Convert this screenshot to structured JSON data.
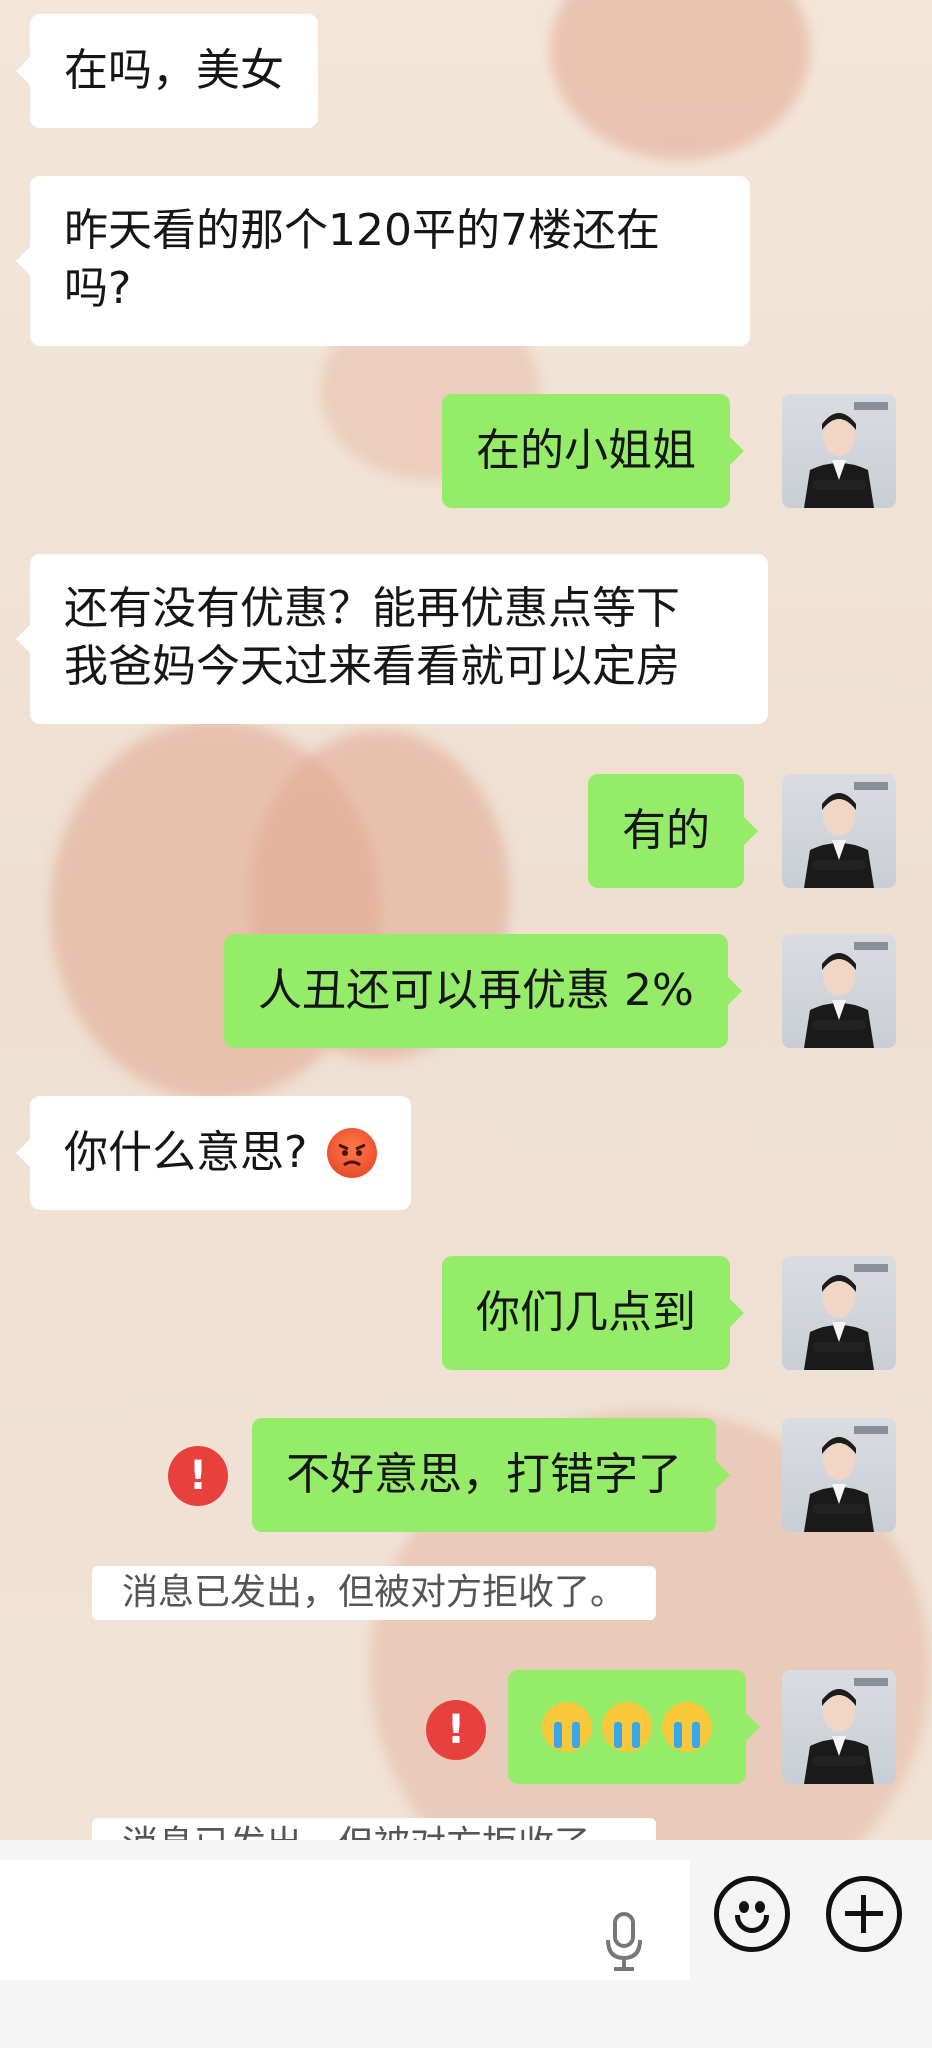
{
  "messages": [
    {
      "side": "left",
      "text": "在吗，美女"
    },
    {
      "side": "left",
      "line1": "昨天看的那个120平的7楼还在",
      "line2": "吗?"
    },
    {
      "side": "right",
      "text": "在的小姐姐"
    },
    {
      "side": "left",
      "line1": "还有没有优惠？能再优惠点等下",
      "line2": "我爸妈今天过来看看就可以定房"
    },
    {
      "side": "right",
      "text": "有的"
    },
    {
      "side": "right",
      "text": "人丑还可以再优惠 2%"
    },
    {
      "side": "left",
      "text": "你什么意思?"
    },
    {
      "side": "right",
      "text": "你们几点到"
    },
    {
      "side": "right",
      "text": "不好意思，打错字了",
      "failed": true
    },
    {
      "side": "right",
      "text": "",
      "emoji": "cry-x3",
      "failed": true
    }
  ],
  "system_notices": [
    "消息已发出，但被对方拒收了。",
    "消息已发出，但被对方拒收了。"
  ],
  "error_mark": "!",
  "colors": {
    "right_bubble": "#95ec69",
    "left_bubble": "#ffffff",
    "error": "#e8413d"
  },
  "icons": [
    "mic-icon",
    "emoji-icon",
    "plus-icon",
    "angry-emoji",
    "crying-emoji"
  ]
}
